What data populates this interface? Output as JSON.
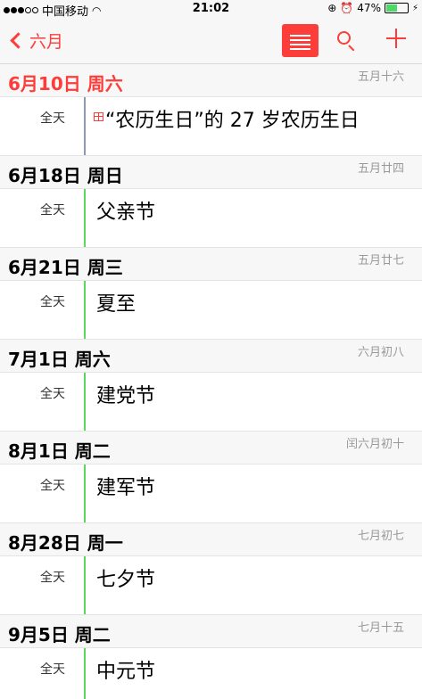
{
  "status_bar": {
    "carrier": "中国移动",
    "time": "21:02",
    "battery": "47%",
    "battery_level": 0.47
  },
  "nav": {
    "back_label": "六月"
  },
  "sections": [
    {
      "date": "6月10日 周六",
      "lunar": "五月十六",
      "allday": "全天",
      "title": "“农历生日”的 27 岁农历生日",
      "today": true
    },
    {
      "date": "6月18日 周日",
      "lunar": "五月廿四",
      "allday": "全天",
      "title": "父亲节"
    },
    {
      "date": "6月21日 周三",
      "lunar": "五月廿七",
      "allday": "全天",
      "title": "夏至"
    },
    {
      "date": "7月1日 周六",
      "lunar": "六月初八",
      "allday": "全天",
      "title": "建党节"
    },
    {
      "date": "8月1日 周二",
      "lunar": "闰六月初十",
      "allday": "全天",
      "title": "建军节"
    },
    {
      "date": "8月28日 周一",
      "lunar": "七月初七",
      "allday": "全天",
      "title": "七夕节"
    },
    {
      "date": "9月5日 周二",
      "lunar": "七月十五",
      "allday": "全天",
      "title": "中元节"
    }
  ],
  "colors": {
    "accent": "#fc3d39",
    "holiday_calendar": "#5bd85b",
    "birthday_calendar": "#8e99ad"
  }
}
